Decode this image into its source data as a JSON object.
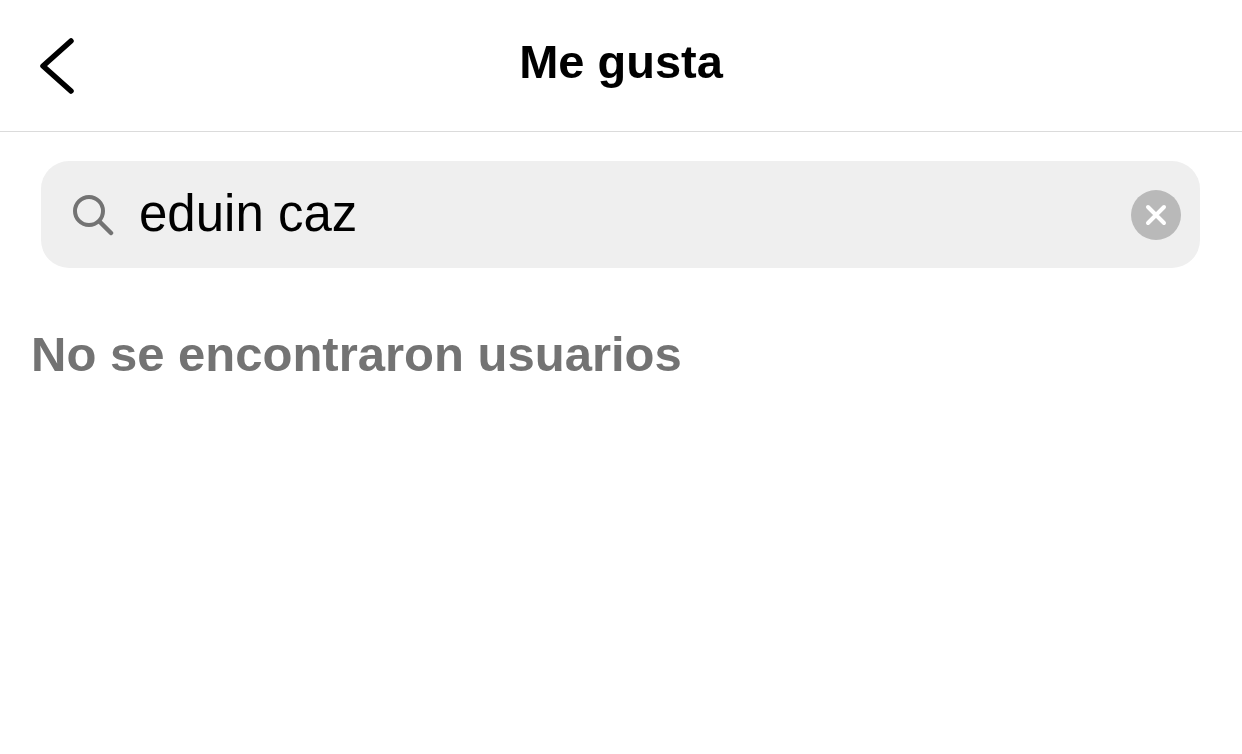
{
  "header": {
    "title": "Me gusta"
  },
  "search": {
    "value": "eduin caz"
  },
  "results": {
    "message": "No se encontraron usuarios"
  }
}
